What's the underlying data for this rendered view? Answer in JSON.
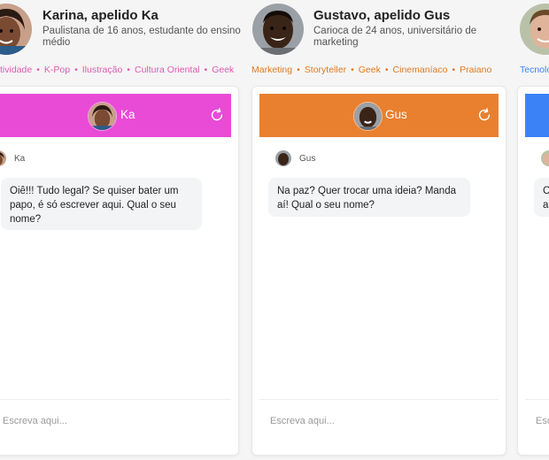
{
  "personas": [
    {
      "name": "Karina, apelido Ka",
      "description": "Paulistana de 16 anos, estudante do ensino médio",
      "tags": [
        "tividade",
        "K-Pop",
        "Ilustração",
        "Cultura Oriental",
        "Geek"
      ],
      "chat_title": "Ka",
      "sender": "Ka",
      "message": "Oiê!!! Tudo legal? Se quiser bater um papo, é só escrever aqui. Qual o seu nome?",
      "input_placeholder": "Escreva aqui...",
      "colors": {
        "header": "#e94bd6",
        "tags": "#e05ab4"
      }
    },
    {
      "name": "Gustavo, apelido Gus",
      "description": "Carioca de 24 anos, universitário de marketing",
      "tags": [
        "Marketing",
        "Storyteller",
        "Geek",
        "Cinemaníaco",
        "Praiano"
      ],
      "chat_title": "Gus",
      "sender": "Gus",
      "message": "Na paz? Quer trocar uma ideia? Manda aí! Qual o seu nome?",
      "input_placeholder": "Escreva aqui...",
      "colors": {
        "header": "#e88030",
        "tags": "#e07a20"
      }
    },
    {
      "name": "",
      "description": "",
      "tags": [
        "Tecnolo"
      ],
      "chat_title": "",
      "sender": "",
      "message": "C",
      "message_line2": "a",
      "input_placeholder": "Esc",
      "colors": {
        "header": "#3b82f6",
        "tags": "#3b82f6"
      }
    }
  ],
  "icons": {
    "refresh": "refresh-icon",
    "avatar": "avatar-icon"
  }
}
